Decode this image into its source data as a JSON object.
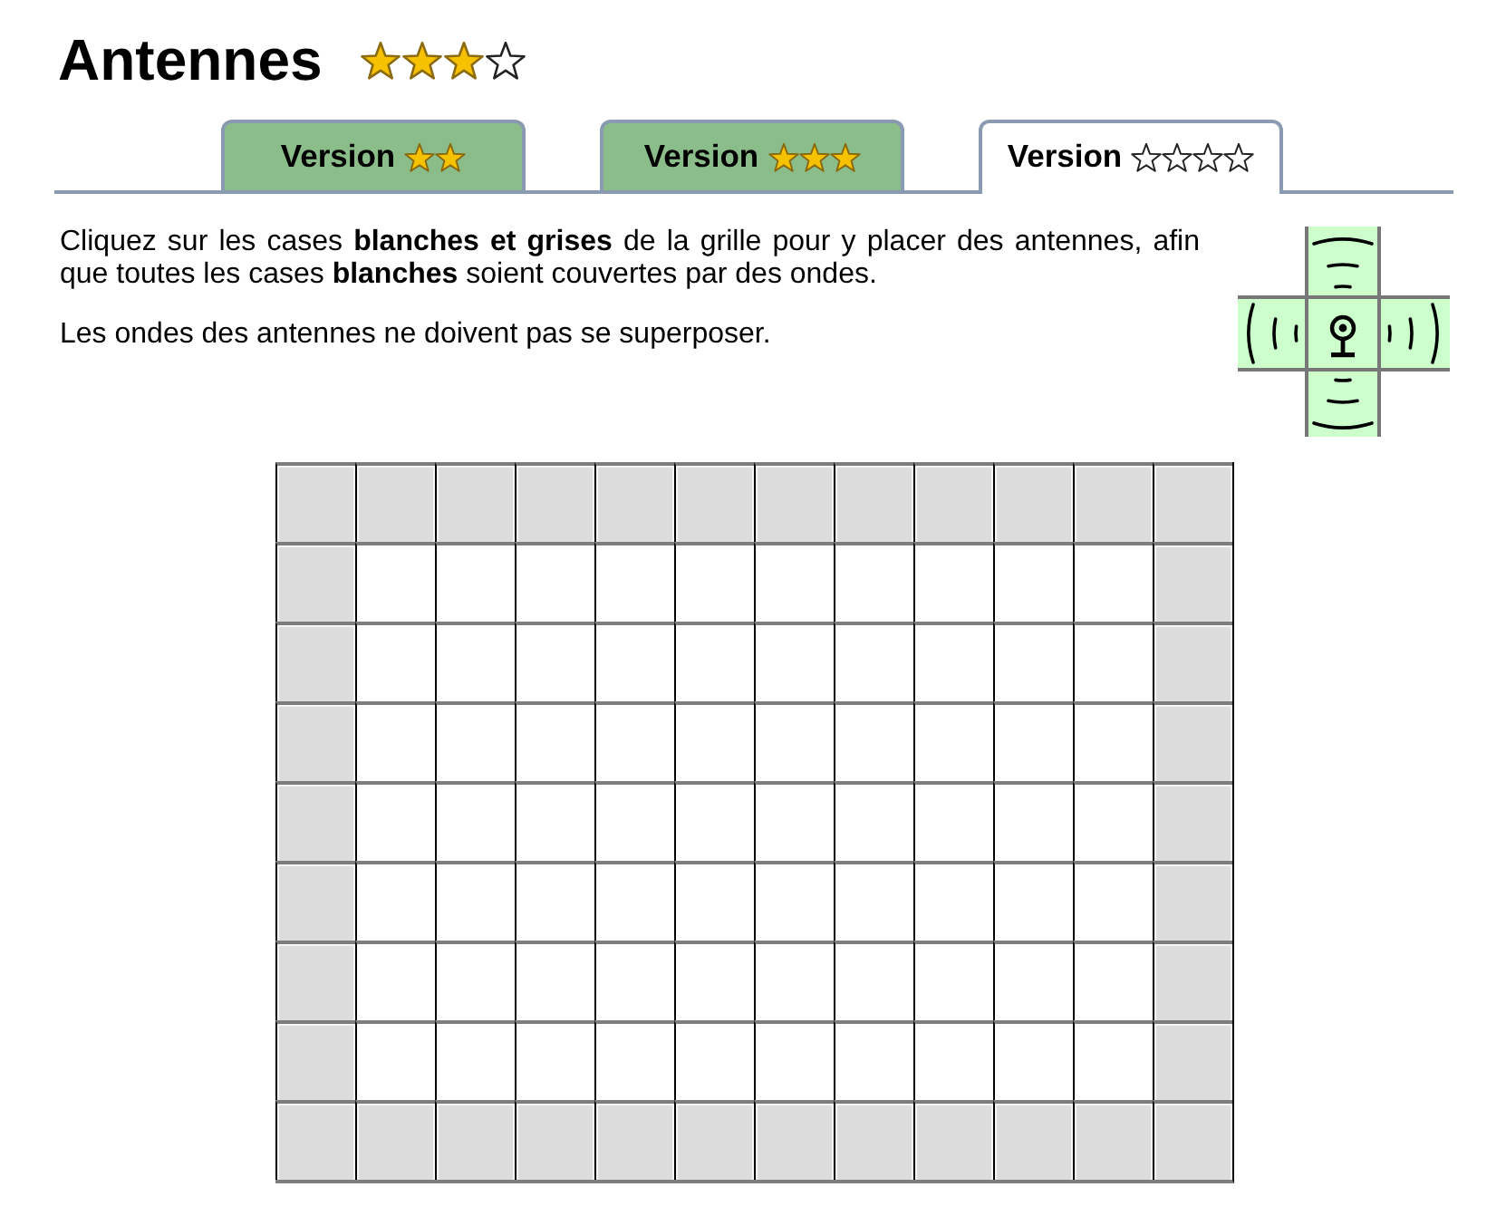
{
  "page": {
    "title": "Antennes",
    "rating": [
      {
        "filled": true
      },
      {
        "filled": true
      },
      {
        "filled": true
      },
      {
        "filled": false
      }
    ]
  },
  "tabs": [
    {
      "label": "Version",
      "selected": false,
      "rating": [
        {
          "filled": true
        },
        {
          "filled": true
        }
      ]
    },
    {
      "label": "Version",
      "selected": false,
      "rating": [
        {
          "filled": true
        },
        {
          "filled": true
        },
        {
          "filled": true
        }
      ]
    },
    {
      "label": "Version",
      "selected": true,
      "rating": [
        {
          "filled": false
        },
        {
          "filled": false
        },
        {
          "filled": false
        },
        {
          "filled": false
        }
      ]
    }
  ],
  "instructions": [
    "Cliquez sur les cases **blanches et grises** de la grille pour y placer des antennes, afin que toutes les cases **blanches** soient couvertes par des ondes.",
    "Les ondes des antennes ne doivent pas se superposer."
  ],
  "grid": {
    "rows": [
      [
        {
          "kind": "gray"
        },
        {
          "kind": "gray"
        },
        {
          "kind": "gray"
        },
        {
          "kind": "gray"
        },
        {
          "kind": "gray"
        },
        {
          "kind": "gray"
        },
        {
          "kind": "gray"
        },
        {
          "kind": "gray"
        },
        {
          "kind": "gray"
        },
        {
          "kind": "gray"
        },
        {
          "kind": "gray"
        },
        {
          "kind": "gray"
        }
      ],
      [
        {
          "kind": "gray"
        },
        {
          "kind": "white"
        },
        {
          "kind": "white"
        },
        {
          "kind": "white"
        },
        {
          "kind": "white"
        },
        {
          "kind": "white"
        },
        {
          "kind": "white"
        },
        {
          "kind": "white"
        },
        {
          "kind": "white"
        },
        {
          "kind": "white"
        },
        {
          "kind": "white"
        },
        {
          "kind": "gray"
        }
      ],
      [
        {
          "kind": "gray"
        },
        {
          "kind": "white"
        },
        {
          "kind": "white"
        },
        {
          "kind": "white"
        },
        {
          "kind": "white"
        },
        {
          "kind": "white"
        },
        {
          "kind": "white"
        },
        {
          "kind": "white"
        },
        {
          "kind": "white"
        },
        {
          "kind": "white"
        },
        {
          "kind": "white"
        },
        {
          "kind": "gray"
        }
      ],
      [
        {
          "kind": "gray"
        },
        {
          "kind": "white"
        },
        {
          "kind": "white"
        },
        {
          "kind": "white"
        },
        {
          "kind": "white"
        },
        {
          "kind": "white"
        },
        {
          "kind": "white"
        },
        {
          "kind": "white"
        },
        {
          "kind": "white"
        },
        {
          "kind": "white"
        },
        {
          "kind": "white"
        },
        {
          "kind": "gray"
        }
      ],
      [
        {
          "kind": "gray"
        },
        {
          "kind": "white"
        },
        {
          "kind": "white"
        },
        {
          "kind": "white"
        },
        {
          "kind": "white"
        },
        {
          "kind": "white"
        },
        {
          "kind": "white"
        },
        {
          "kind": "white"
        },
        {
          "kind": "white"
        },
        {
          "kind": "white"
        },
        {
          "kind": "white"
        },
        {
          "kind": "gray"
        }
      ],
      [
        {
          "kind": "gray"
        },
        {
          "kind": "white"
        },
        {
          "kind": "white"
        },
        {
          "kind": "white"
        },
        {
          "kind": "white"
        },
        {
          "kind": "white"
        },
        {
          "kind": "white"
        },
        {
          "kind": "white"
        },
        {
          "kind": "white"
        },
        {
          "kind": "white"
        },
        {
          "kind": "white"
        },
        {
          "kind": "gray"
        }
      ],
      [
        {
          "kind": "gray"
        },
        {
          "kind": "white"
        },
        {
          "kind": "white"
        },
        {
          "kind": "white"
        },
        {
          "kind": "white"
        },
        {
          "kind": "white"
        },
        {
          "kind": "white"
        },
        {
          "kind": "white"
        },
        {
          "kind": "white"
        },
        {
          "kind": "white"
        },
        {
          "kind": "white"
        },
        {
          "kind": "gray"
        }
      ],
      [
        {
          "kind": "gray"
        },
        {
          "kind": "white"
        },
        {
          "kind": "white"
        },
        {
          "kind": "white"
        },
        {
          "kind": "white"
        },
        {
          "kind": "white"
        },
        {
          "kind": "white"
        },
        {
          "kind": "white"
        },
        {
          "kind": "white"
        },
        {
          "kind": "white"
        },
        {
          "kind": "white"
        },
        {
          "kind": "gray"
        }
      ],
      [
        {
          "kind": "gray"
        },
        {
          "kind": "gray"
        },
        {
          "kind": "gray"
        },
        {
          "kind": "gray"
        },
        {
          "kind": "gray"
        },
        {
          "kind": "gray"
        },
        {
          "kind": "gray"
        },
        {
          "kind": "gray"
        },
        {
          "kind": "gray"
        },
        {
          "kind": "gray"
        },
        {
          "kind": "gray"
        },
        {
          "kind": "gray"
        }
      ]
    ]
  }
}
